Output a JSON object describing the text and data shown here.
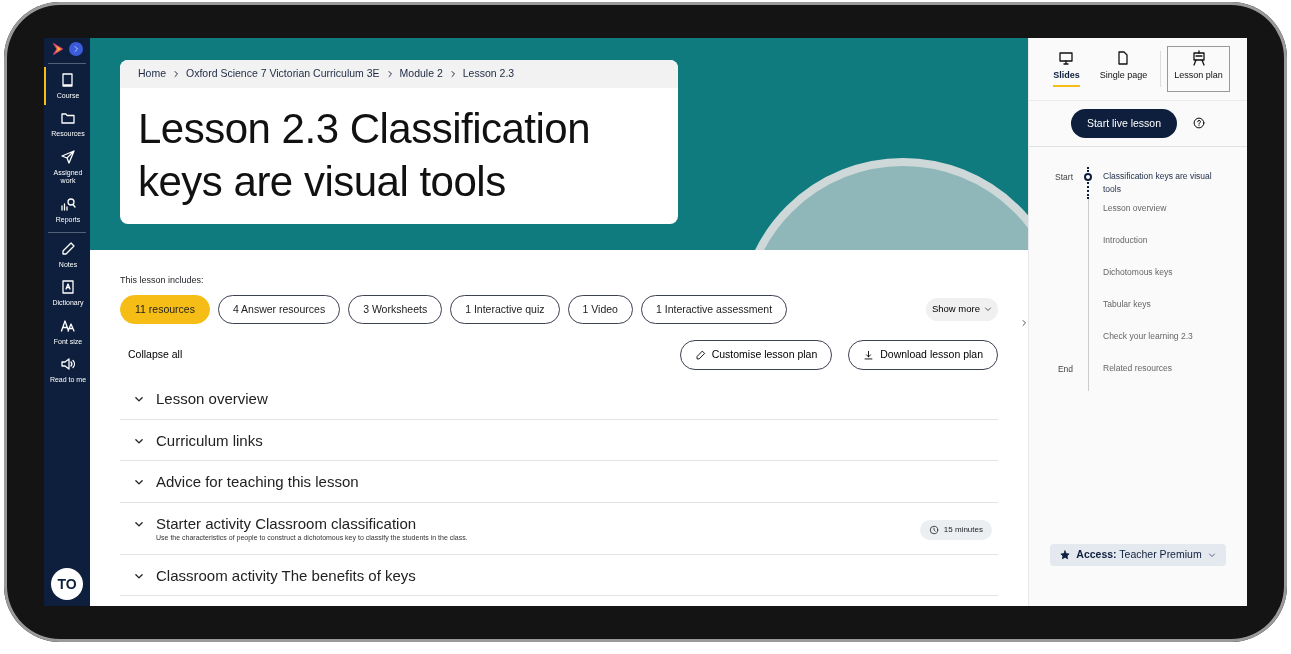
{
  "sidebar": {
    "items": [
      {
        "label": "Course",
        "selected": true
      },
      {
        "label": "Resources",
        "selected": false
      },
      {
        "label": "Assigned work",
        "selected": false
      },
      {
        "label": "Reports",
        "selected": false
      },
      {
        "label": "Notes",
        "selected": false
      },
      {
        "label": "Dictionary",
        "selected": false
      },
      {
        "label": "Font size",
        "selected": false
      },
      {
        "label": "Read to me",
        "selected": false
      }
    ],
    "avatar": "TO"
  },
  "breadcrumb": [
    "Home",
    "Oxford Science 7 Victorian Curriculum 3E",
    "Module 2",
    "Lesson 2.3"
  ],
  "title": "Lesson 2.3 Classification keys are visual tools",
  "includes_label": "This lesson includes:",
  "chips": [
    {
      "label": "11 resources",
      "selected": true
    },
    {
      "label": "4 Answer resources",
      "selected": false
    },
    {
      "label": "3 Worksheets",
      "selected": false
    },
    {
      "label": "1 Interactive quiz",
      "selected": false
    },
    {
      "label": "1 Video",
      "selected": false
    },
    {
      "label": "1 Interactive assessment",
      "selected": false
    }
  ],
  "show_more": "Show more",
  "collapse_all": "Collapse all",
  "actions": [
    "Customise lesson plan",
    "Download lesson plan"
  ],
  "sections": [
    {
      "title": "Lesson overview"
    },
    {
      "title": "Curriculum links"
    },
    {
      "title": "Advice for teaching this lesson"
    },
    {
      "title": "Starter activity Classroom classification",
      "description": "Use the characteristics of people to construct a dichotomous key to classify the students in the class.",
      "duration": "15 minutes"
    },
    {
      "title": "Classroom activity The benefits of keys"
    }
  ],
  "view_tabs": [
    {
      "label": "Slides",
      "selected": true,
      "outlined": false
    },
    {
      "label": "Single page",
      "selected": false,
      "outlined": false
    },
    {
      "label": "Lesson plan",
      "selected": false,
      "outlined": true
    }
  ],
  "start_button": "Start live lesson",
  "timeline": [
    {
      "marker": "Start",
      "label": "Classification keys are visual tools",
      "current": true
    },
    {
      "label": "Lesson overview",
      "current": false
    },
    {
      "label": "Introduction",
      "current": false
    },
    {
      "label": "Dichotomous keys",
      "current": false
    },
    {
      "label": "Tabular keys",
      "current": false
    },
    {
      "label": "Check your learning 2.3",
      "current": false
    },
    {
      "marker": "End",
      "label": "Related resources",
      "current": false
    }
  ],
  "access": "**Access:** Teacher Premium"
}
